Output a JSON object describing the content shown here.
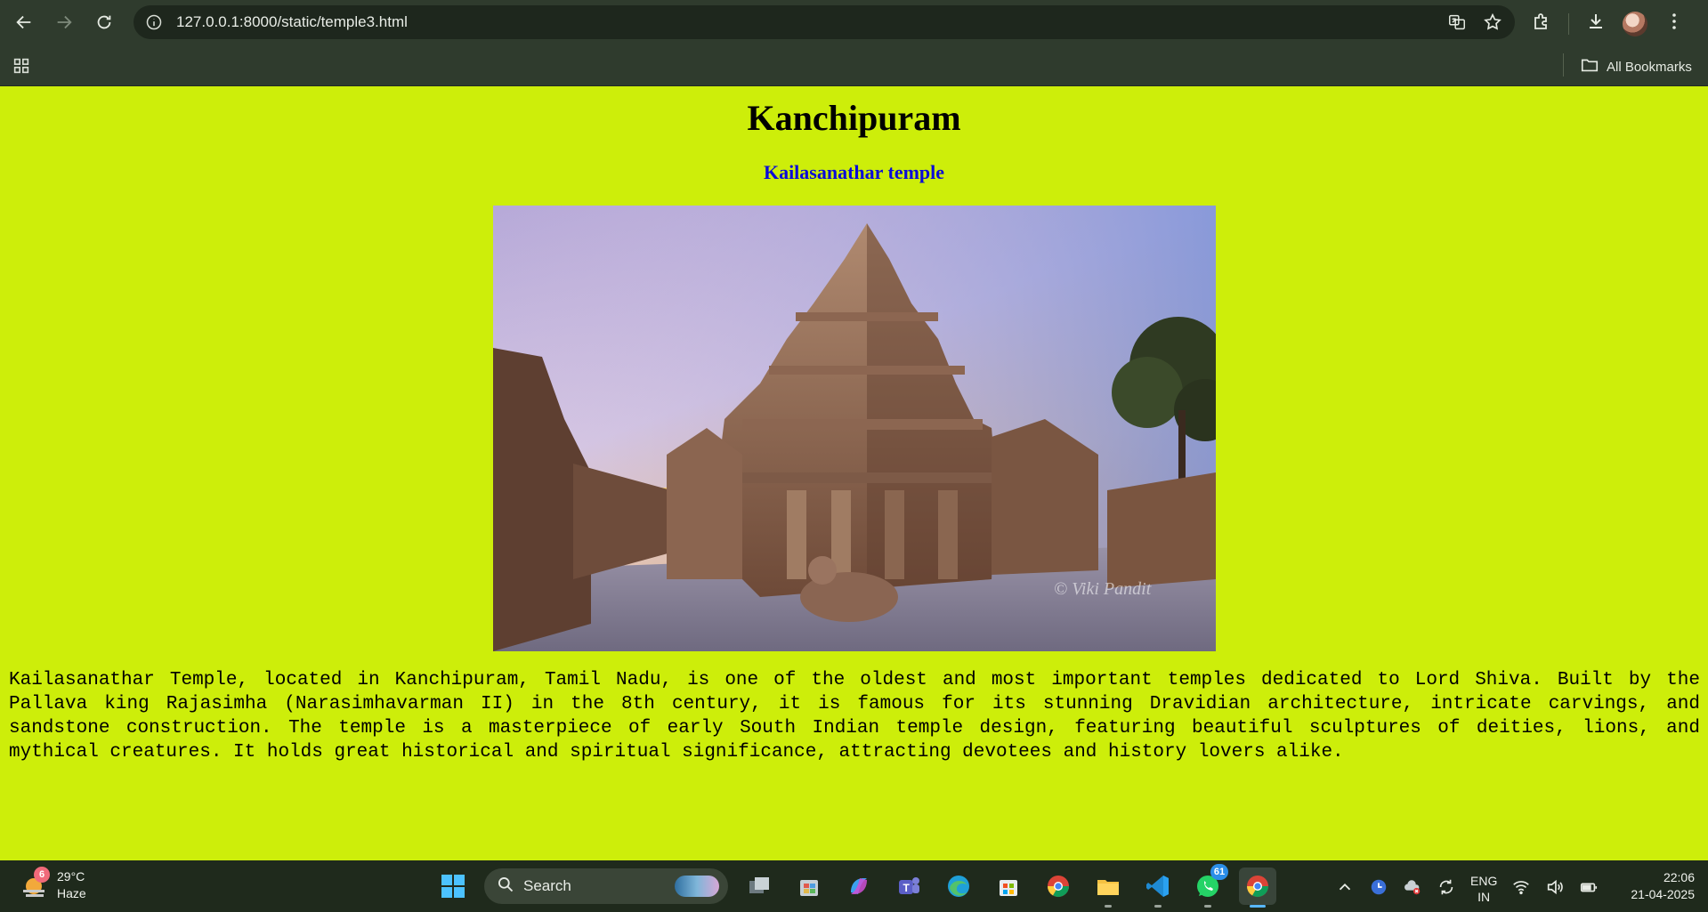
{
  "browser": {
    "url": "127.0.0.1:8000/static/temple3.html",
    "bookmarks_label": "All Bookmarks"
  },
  "page": {
    "title": "Kanchipuram",
    "subtitle": "Kailasanathar temple",
    "description": "Kailasanathar Temple, located in Kanchipuram, Tamil Nadu, is one of the oldest and most important temples dedicated to Lord Shiva. Built by the Pallava king Rajasimha (Narasimhavarman II) in the 8th century, it is famous for its stunning Dravidian architecture, intricate carvings, and sandstone construction. The temple is a masterpiece of early South Indian temple design, featuring beautiful sculptures of deities, lions, and mythical creatures. It holds great historical and spiritual significance, attracting devotees and history lovers alike.",
    "photo_watermark": "© Viki Pandit"
  },
  "taskbar": {
    "weather_temp": "29°C",
    "weather_desc": "Haze",
    "weather_badge": "6",
    "search_placeholder": "Search",
    "whatsapp_badge": "61",
    "lang_line1": "ENG",
    "lang_line2": "IN",
    "time": "22:06",
    "date": "21-04-2025"
  },
  "colors": {
    "page_background": "#cdee0a",
    "subtitle": "#0a0ad8",
    "chrome": "#2f3b2d"
  }
}
